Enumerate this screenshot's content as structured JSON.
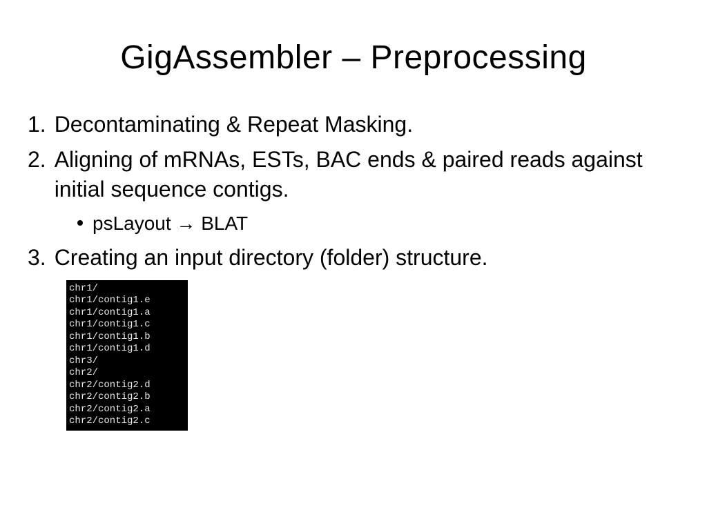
{
  "title": "GigAssembler – Preprocessing",
  "items": [
    {
      "n": "1.",
      "text": "Decontaminating & Repeat Masking."
    },
    {
      "n": "2.",
      "text": "Aligning of mRNAs, ESTs, BAC ends & paired reads against initial sequence contigs."
    },
    {
      "n": "3.",
      "text": "Creating an input directory (folder) structure."
    }
  ],
  "subitem": "psLayout → BLAT",
  "terminal_lines": [
    "chr1/",
    "chr1/contig1.e",
    "chr1/contig1.a",
    "chr1/contig1.c",
    "chr1/contig1.b",
    "chr1/contig1.d",
    "chr3/",
    "chr2/",
    "chr2/contig2.d",
    "chr2/contig2.b",
    "chr2/contig2.a",
    "chr2/contig2.c"
  ]
}
